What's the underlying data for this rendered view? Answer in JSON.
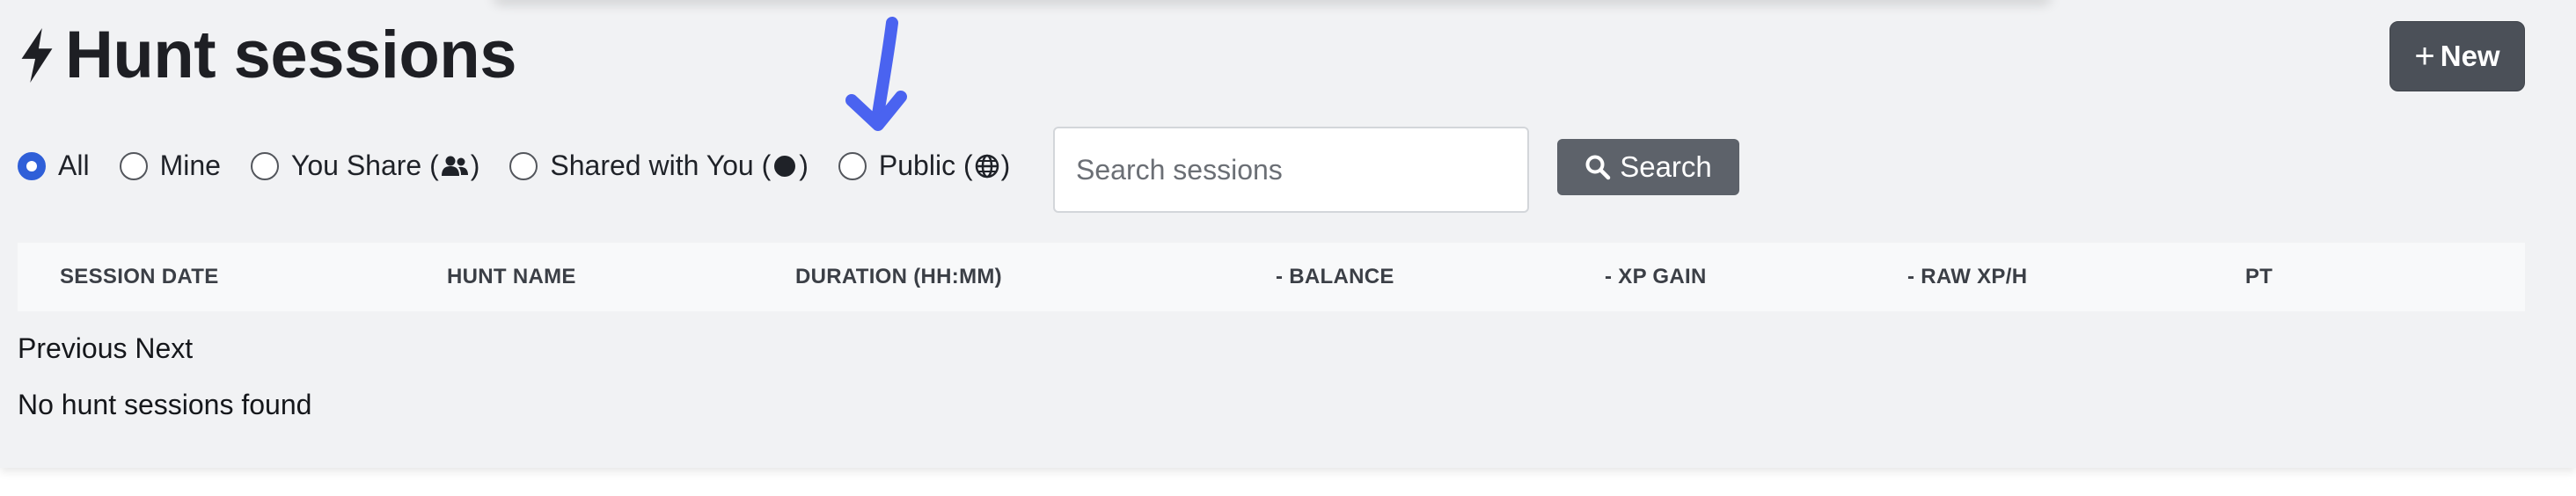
{
  "page": {
    "title": "Hunt sessions",
    "title_icon": "bolt-icon"
  },
  "toolbar": {
    "new_label": "New",
    "new_icon": "plus-icon"
  },
  "filters": {
    "options": [
      {
        "label": "All",
        "icon": null,
        "checked": true
      },
      {
        "label": "Mine",
        "icon": null,
        "checked": false
      },
      {
        "label": "You Share",
        "icon": "users-icon",
        "checked": false
      },
      {
        "label": "Shared with You",
        "icon": "filled-circle-icon",
        "checked": false
      },
      {
        "label": "Public",
        "icon": "globe-icon",
        "checked": false
      }
    ]
  },
  "search": {
    "placeholder": "Search sessions",
    "value": "",
    "button_label": "Search",
    "button_icon": "search-icon"
  },
  "annotation": {
    "icon": "arrow-down-icon",
    "color": "#4a63f0"
  },
  "table": {
    "columns": [
      "SESSION DATE",
      "HUNT NAME",
      "DURATION (HH:MM)",
      "- BALANCE",
      "- XP GAIN",
      "- RAW XP/H",
      "PT"
    ],
    "rows": []
  },
  "pagination": {
    "previous_label": "Previous",
    "next_label": "Next"
  },
  "empty_state": "No hunt sessions found",
  "colors": {
    "accent": "#2f5fd8",
    "button_dark": "#4b5058",
    "button_secondary": "#5d626a",
    "panel_bg": "#f1f2f4"
  }
}
